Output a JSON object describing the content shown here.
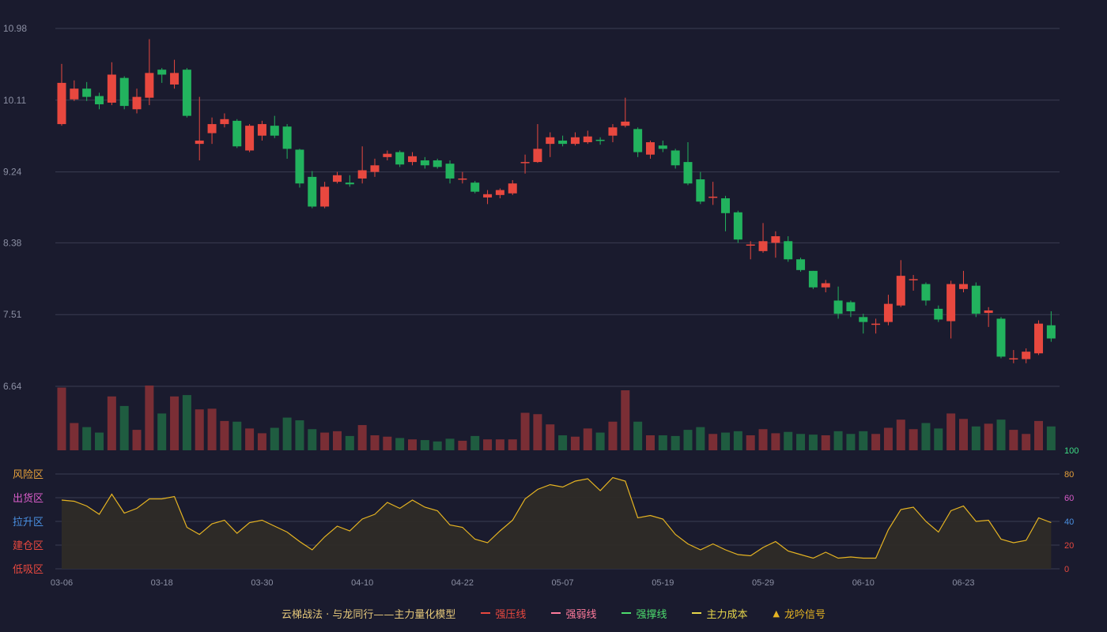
{
  "colors": {
    "background": "#1a1b2e",
    "grid": "#3a3d52",
    "axis_text": "#8b8fa3",
    "up": "#e8483f",
    "down": "#22b35e",
    "vol_up": "#7a2e35",
    "vol_down": "#1f5c40",
    "line": "#e6b422",
    "area": "#2e2b27"
  },
  "chart_data": [
    {
      "type": "candlestick",
      "title": "",
      "ylim": [
        6.64,
        10.98
      ],
      "y_ticks": [
        "10.98",
        "10.11",
        "9.24",
        "8.38",
        "7.51",
        "6.64"
      ],
      "x_ticks": [
        {
          "label": "03-06",
          "index": 0
        },
        {
          "label": "03-18",
          "index": 8
        },
        {
          "label": "03-30",
          "index": 16
        },
        {
          "label": "04-10",
          "index": 24
        },
        {
          "label": "04-22",
          "index": 32
        },
        {
          "label": "05-07",
          "index": 40
        },
        {
          "label": "05-19",
          "index": 48
        },
        {
          "label": "05-29",
          "index": 56
        },
        {
          "label": "06-10",
          "index": 64
        },
        {
          "label": "06-23",
          "index": 72
        }
      ],
      "candles": [
        [
          9.82,
          10.32,
          10.55,
          9.8
        ],
        [
          10.12,
          10.25,
          10.35,
          10.1
        ],
        [
          10.25,
          10.15,
          10.33,
          10.1
        ],
        [
          10.16,
          10.06,
          10.2,
          10.0
        ],
        [
          10.08,
          10.42,
          10.57,
          10.05
        ],
        [
          10.38,
          10.04,
          10.4,
          10.0
        ],
        [
          10.0,
          10.15,
          10.25,
          9.95
        ],
        [
          10.14,
          10.44,
          10.85,
          10.05
        ],
        [
          10.48,
          10.42,
          10.5,
          10.32
        ],
        [
          10.3,
          10.44,
          10.6,
          10.25
        ],
        [
          10.48,
          9.92,
          10.5,
          9.9
        ],
        [
          9.58,
          9.62,
          10.15,
          9.38
        ],
        [
          9.71,
          9.82,
          9.9,
          9.58
        ],
        [
          9.82,
          9.88,
          9.95,
          9.78
        ],
        [
          9.86,
          9.55,
          9.88,
          9.53
        ],
        [
          9.5,
          9.8,
          9.82,
          9.48
        ],
        [
          9.68,
          9.82,
          9.86,
          9.62
        ],
        [
          9.8,
          9.68,
          9.92,
          9.65
        ],
        [
          9.79,
          9.52,
          9.82,
          9.4
        ],
        [
          9.51,
          9.1,
          9.52,
          9.05
        ],
        [
          9.18,
          8.82,
          9.25,
          8.8
        ],
        [
          8.82,
          9.06,
          9.12,
          8.8
        ],
        [
          9.12,
          9.2,
          9.24,
          9.1
        ],
        [
          9.11,
          9.09,
          9.2,
          9.06
        ],
        [
          9.16,
          9.26,
          9.55,
          9.1
        ],
        [
          9.24,
          9.32,
          9.4,
          9.18
        ],
        [
          9.42,
          9.46,
          9.5,
          9.38
        ],
        [
          9.48,
          9.33,
          9.5,
          9.3
        ],
        [
          9.36,
          9.43,
          9.48,
          9.32
        ],
        [
          9.38,
          9.32,
          9.42,
          9.28
        ],
        [
          9.38,
          9.3,
          9.4,
          9.28
        ],
        [
          9.34,
          9.16,
          9.38,
          9.1
        ],
        [
          9.16,
          9.16,
          9.24,
          9.1
        ],
        [
          9.11,
          9.0,
          9.13,
          8.98
        ],
        [
          8.93,
          8.97,
          9.02,
          8.85
        ],
        [
          8.96,
          9.02,
          9.04,
          8.92
        ],
        [
          8.98,
          9.1,
          9.14,
          8.96
        ],
        [
          9.36,
          9.36,
          9.45,
          9.22
        ],
        [
          9.36,
          9.52,
          9.82,
          9.35
        ],
        [
          9.58,
          9.66,
          9.72,
          9.42
        ],
        [
          9.62,
          9.58,
          9.68,
          9.55
        ],
        [
          9.58,
          9.66,
          9.72,
          9.56
        ],
        [
          9.6,
          9.67,
          9.74,
          9.58
        ],
        [
          9.63,
          9.62,
          9.66,
          9.57
        ],
        [
          9.68,
          9.78,
          9.82,
          9.6
        ],
        [
          9.8,
          9.85,
          10.14,
          9.78
        ],
        [
          9.76,
          9.48,
          9.78,
          9.42
        ],
        [
          9.45,
          9.6,
          9.62,
          9.4
        ],
        [
          9.56,
          9.52,
          9.62,
          9.48
        ],
        [
          9.5,
          9.32,
          9.52,
          9.28
        ],
        [
          9.36,
          9.1,
          9.6,
          9.08
        ],
        [
          9.15,
          8.88,
          9.24,
          8.85
        ],
        [
          8.94,
          8.94,
          9.12,
          8.84
        ],
        [
          8.92,
          8.74,
          8.95,
          8.52
        ],
        [
          8.75,
          8.42,
          8.77,
          8.38
        ],
        [
          8.36,
          8.36,
          8.4,
          8.18
        ],
        [
          8.28,
          8.4,
          8.62,
          8.26
        ],
        [
          8.38,
          8.46,
          8.52,
          8.2
        ],
        [
          8.4,
          8.18,
          8.46,
          8.15
        ],
        [
          8.18,
          8.05,
          8.2,
          8.03
        ],
        [
          8.04,
          7.84,
          8.04,
          7.82
        ],
        [
          7.84,
          7.89,
          7.93,
          7.78
        ],
        [
          7.68,
          7.52,
          7.85,
          7.46
        ],
        [
          7.66,
          7.55,
          7.68,
          7.48
        ],
        [
          7.48,
          7.42,
          7.52,
          7.28
        ],
        [
          7.4,
          7.4,
          7.46,
          7.28
        ],
        [
          7.42,
          7.64,
          7.75,
          7.38
        ],
        [
          7.62,
          7.98,
          8.17,
          7.6
        ],
        [
          7.94,
          7.94,
          7.99,
          7.8
        ],
        [
          7.88,
          7.68,
          7.9,
          7.62
        ],
        [
          7.58,
          7.45,
          7.62,
          7.42
        ],
        [
          7.43,
          7.88,
          7.92,
          7.22
        ],
        [
          7.82,
          7.88,
          8.04,
          7.78
        ],
        [
          7.86,
          7.52,
          7.9,
          7.48
        ],
        [
          7.53,
          7.56,
          7.6,
          7.36
        ],
        [
          7.46,
          7.0,
          7.48,
          6.98
        ],
        [
          6.98,
          6.98,
          7.08,
          6.92
        ],
        [
          6.97,
          7.06,
          7.1,
          6.92
        ],
        [
          7.04,
          7.4,
          7.44,
          7.02
        ],
        [
          7.38,
          7.22,
          7.55,
          7.18
        ]
      ],
      "volume": [
        92,
        40,
        34,
        26,
        79,
        65,
        30,
        95,
        54,
        79,
        81,
        60,
        61,
        43,
        42,
        32,
        25,
        33,
        48,
        44,
        31,
        26,
        28,
        21,
        37,
        22,
        20,
        18,
        16,
        15,
        13,
        17,
        14,
        21,
        16,
        16,
        16,
        55,
        53,
        38,
        22,
        20,
        32,
        26,
        42,
        88,
        42,
        22,
        22,
        21,
        30,
        34,
        24,
        26,
        28,
        22,
        31,
        25,
        27,
        24,
        23,
        22,
        28,
        24,
        28,
        24,
        33,
        45,
        31,
        40,
        32,
        54,
        46,
        35,
        39,
        45,
        30,
        24,
        43,
        35
      ]
    },
    {
      "type": "area",
      "ylim": [
        0,
        100
      ],
      "y_ticks": [
        "100",
        "80",
        "60",
        "40",
        "20",
        "0"
      ],
      "zone_labels": [
        {
          "label": "风险区",
          "color": "#e6a03a"
        },
        {
          "label": "出货区",
          "color": "#d85cc8"
        },
        {
          "label": "拉升区",
          "color": "#4a90e2"
        },
        {
          "label": "建仓区",
          "color": "#e8483f"
        },
        {
          "label": "低吸区",
          "color": "#e8483f"
        }
      ],
      "tick_colors": [
        "#3ddc84",
        "#e6a03a",
        "#d85cc8",
        "#4a90e2",
        "#e8483f",
        "#e8483f"
      ],
      "values": [
        58,
        57,
        53,
        46,
        63,
        47,
        51,
        59,
        59,
        61,
        35,
        29,
        38,
        41,
        30,
        39,
        41,
        36,
        31,
        23,
        16,
        27,
        36,
        32,
        42,
        46,
        56,
        51,
        58,
        52,
        49,
        37,
        35,
        25,
        22,
        32,
        41,
        59,
        67,
        71,
        69,
        74,
        76,
        66,
        77,
        74,
        43,
        45,
        42,
        29,
        21,
        16,
        21,
        16,
        12,
        11,
        18,
        23,
        15,
        12,
        9,
        14,
        9,
        10,
        9,
        9,
        33,
        50,
        52,
        40,
        31,
        49,
        53,
        40,
        41,
        25,
        22,
        24,
        43,
        39
      ]
    }
  ],
  "legend": {
    "title": "云梯战法 · 与龙同行——主力量化模型",
    "title_color": "#e6c87a",
    "items": [
      {
        "name": "强压线",
        "color": "#e8483f",
        "style": "line"
      },
      {
        "name": "强弱线",
        "color": "#ff7b9c",
        "style": "dash"
      },
      {
        "name": "强撑线",
        "color": "#4ddc6e",
        "style": "line"
      },
      {
        "name": "主力成本",
        "color": "#e6d64a",
        "style": "dash"
      },
      {
        "name": "龙吟信号",
        "color": "#e6b422",
        "style": "triangle"
      }
    ]
  }
}
